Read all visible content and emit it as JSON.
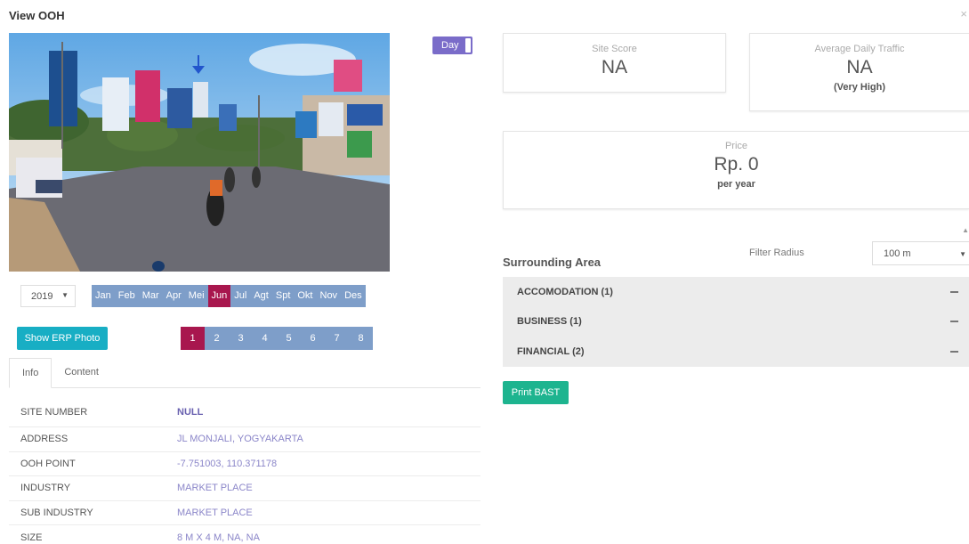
{
  "modal": {
    "title": "View OOH",
    "close_glyph": "×"
  },
  "photo": {
    "toggle_label": "Day"
  },
  "year": {
    "selected": "2019",
    "caret": "▼"
  },
  "months": [
    {
      "label": "Jan",
      "active": false
    },
    {
      "label": "Feb",
      "active": false
    },
    {
      "label": "Mar",
      "active": false
    },
    {
      "label": "Apr",
      "active": false
    },
    {
      "label": "Mei",
      "active": false
    },
    {
      "label": "Jun",
      "active": true
    },
    {
      "label": "Jul",
      "active": false
    },
    {
      "label": "Agt",
      "active": false
    },
    {
      "label": "Spt",
      "active": false
    },
    {
      "label": "Okt",
      "active": false
    },
    {
      "label": "Nov",
      "active": false
    },
    {
      "label": "Des",
      "active": false
    }
  ],
  "erp_button": "Show ERP Photo",
  "pages": [
    "1",
    "2",
    "3",
    "4",
    "5",
    "6",
    "7",
    "8"
  ],
  "active_page": "1",
  "tabs": [
    "Info",
    "Content"
  ],
  "active_tab": "Info",
  "info": [
    {
      "key": "SITE NUMBER",
      "value": "NULL"
    },
    {
      "key": "ADDRESS",
      "value": "JL MONJALI, YOGYAKARTA"
    },
    {
      "key": "OOH POINT",
      "value": "-7.751003, 110.371178"
    },
    {
      "key": "INDUSTRY",
      "value": "MARKET PLACE"
    },
    {
      "key": "SUB INDUSTRY",
      "value": "MARKET PLACE"
    },
    {
      "key": "SIZE",
      "value": "8 M X 4 M, NA, NA"
    }
  ],
  "site_score": {
    "label": "Site Score",
    "value": "NA"
  },
  "traffic": {
    "label": "Average Daily Traffic",
    "value": "NA",
    "sub": "(Very High)"
  },
  "price": {
    "label": "Price",
    "value": "Rp. 0",
    "sub": "per year"
  },
  "surrounding": {
    "title": "Surrounding Area",
    "filter_label": "Filter Radius",
    "filter_value": "100 m",
    "caret": "▼",
    "scroll_glyph": "▲",
    "items": [
      "ACCOMODATION (1)",
      "BUSINESS (1)",
      "FINANCIAL (2)"
    ]
  },
  "print_button": "Print BAST",
  "colors": {
    "accent_active": "#a8174e",
    "tab_blue": "#7e9ec9",
    "teal": "#18aec4",
    "green": "#1db48f",
    "toggle": "#7a6cc9"
  }
}
